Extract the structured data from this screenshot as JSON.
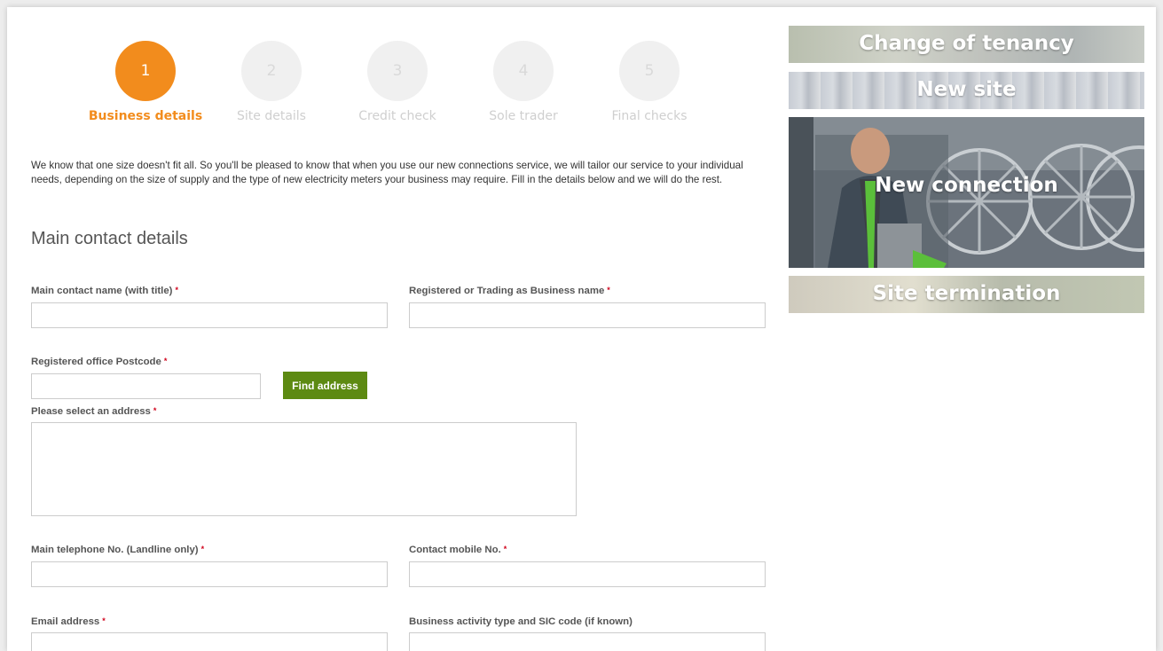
{
  "stepper": {
    "steps": [
      {
        "number": "1",
        "label": "Business details"
      },
      {
        "number": "2",
        "label": "Site details"
      },
      {
        "number": "3",
        "label": "Credit check"
      },
      {
        "number": "4",
        "label": "Sole trader"
      },
      {
        "number": "5",
        "label": "Final checks"
      }
    ]
  },
  "intro": "We know that one size doesn't fit all. So you'll be pleased to know that when you use our new connections service, we will tailor our service to your individual needs, depending on the size of supply and the type of new electricity meters your business may require. Fill in the details below and we will do the rest.",
  "section_title": "Main contact details",
  "form": {
    "contact_name_label": "Main contact name (with title)",
    "business_name_label": "Registered or Trading as Business name",
    "postcode_label": "Registered office Postcode",
    "find_address_label": "Find address",
    "select_address_label": "Please select an address",
    "telephone_label": "Main telephone No. (Landline only)",
    "mobile_label": "Contact mobile No.",
    "email_label": "Email address",
    "business_activity_label": "Business activity type and SIC code (if known)",
    "required_marker": "*"
  },
  "sidebar": {
    "tiles": [
      {
        "title": "Change of tenancy"
      },
      {
        "title": "New site"
      },
      {
        "title": "New connection"
      },
      {
        "title": "Site termination"
      }
    ]
  },
  "colors": {
    "accent_orange": "#f28c1d",
    "button_green": "#5d8a12",
    "required_red": "#d0021b"
  }
}
